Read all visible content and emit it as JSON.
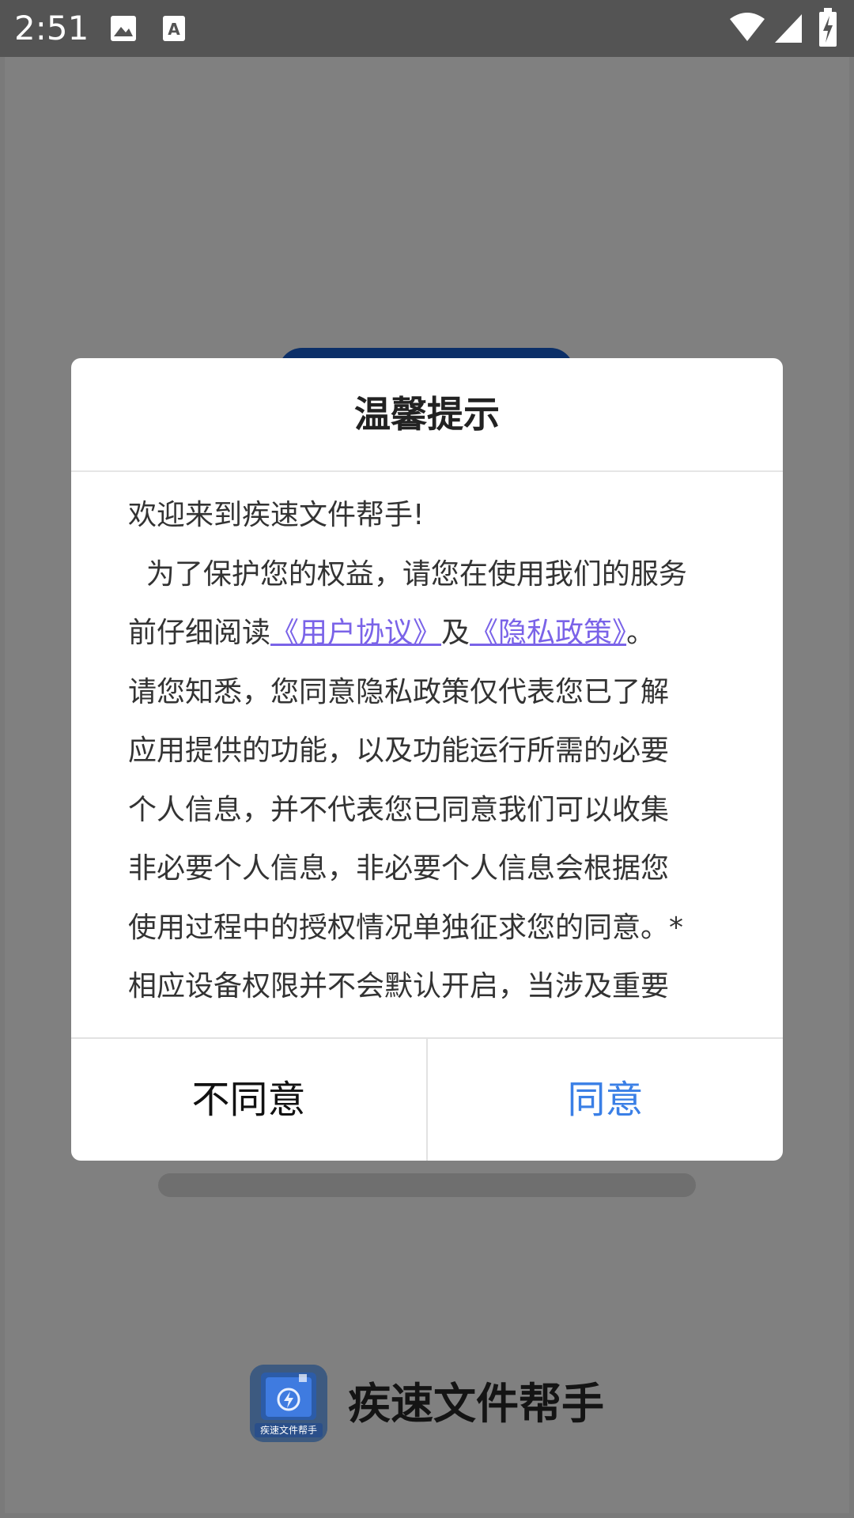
{
  "status_bar": {
    "time": "2:51",
    "icons": [
      "image-icon",
      "keyboard-a-icon",
      "wifi-icon",
      "signal-icon",
      "battery-charging-icon"
    ]
  },
  "dialog": {
    "title": "温馨提示",
    "body": {
      "line1": "欢迎来到疾速文件帮手!",
      "line2": "  为了保护您的权益，请您在使用我们的服务",
      "line3_prefix": "前仔细阅读",
      "user_agreement_link": "《用户协议》",
      "line3_mid": "及",
      "privacy_policy_link": "《隐私政策》",
      "line3_suffix": "。",
      "line4": "请您知悉，您同意隐私政策仅代表您已了解",
      "line5": "应用提供的功能，以及功能运行所需的必要",
      "line6": "个人信息，并不代表您已同意我们可以收集",
      "line7": "非必要个人信息，非必要个人信息会根据您",
      "line8": "使用过程中的授权情况单独征求您的同意。*",
      "line9": "相应设备权限并不会默认开启，当涉及重要"
    },
    "buttons": {
      "disagree": "不同意",
      "agree": "同意"
    }
  },
  "brand": {
    "app_name": "疾速文件帮手",
    "logo_text": "疾速文件帮手"
  },
  "colors": {
    "link": "#7a63e8",
    "agree": "#3a7fe6",
    "overlay": "#808080"
  }
}
